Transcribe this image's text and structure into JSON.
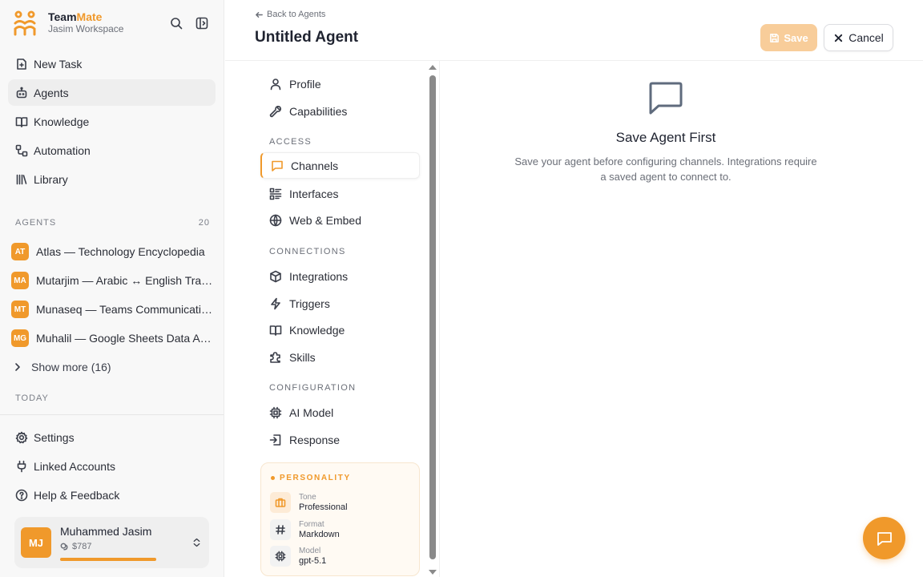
{
  "brand": {
    "name_part1": "Team",
    "name_part2": "Mate",
    "workspace": "Jasim Workspace"
  },
  "sidebar": {
    "nav": [
      {
        "label": "New Task",
        "icon": "new-task-icon"
      },
      {
        "label": "Agents",
        "icon": "robot-icon",
        "active": true
      },
      {
        "label": "Knowledge",
        "icon": "book-icon"
      },
      {
        "label": "Automation",
        "icon": "workflow-icon"
      },
      {
        "label": "Library",
        "icon": "library-icon"
      }
    ],
    "agents_section": {
      "title": "AGENTS",
      "count": "20"
    },
    "agents": [
      {
        "initials": "AT",
        "name": "Atlas — Technology Encyclopedia"
      },
      {
        "initials": "MA",
        "name": "Mutarjim — Arabic ↔ English Translator"
      },
      {
        "initials": "MT",
        "name": "Munaseq — Teams Communication Coordinator"
      },
      {
        "initials": "MG",
        "name": "Muhalil — Google Sheets Data Analyst"
      }
    ],
    "show_more": "Show more (16)",
    "today_title": "TODAY",
    "bottom_nav": [
      {
        "label": "Settings",
        "icon": "gear-icon"
      },
      {
        "label": "Linked Accounts",
        "icon": "plug-icon"
      },
      {
        "label": "Help & Feedback",
        "icon": "help-icon"
      }
    ],
    "user": {
      "initials": "MJ",
      "name": "Muhammed Jasim",
      "credit": "$787"
    }
  },
  "header": {
    "back": "Back to Agents",
    "title": "Untitled Agent",
    "save_label": "Save",
    "cancel_label": "Cancel"
  },
  "settings_nav": {
    "top": [
      {
        "label": "Profile",
        "icon": "user-icon"
      },
      {
        "label": "Capabilities",
        "icon": "wrench-icon"
      }
    ],
    "access_title": "ACCESS",
    "access": [
      {
        "label": "Channels",
        "icon": "chat-icon",
        "active": true
      },
      {
        "label": "Interfaces",
        "icon": "interfaces-icon"
      },
      {
        "label": "Web & Embed",
        "icon": "globe-icon"
      }
    ],
    "connections_title": "CONNECTIONS",
    "connections": [
      {
        "label": "Integrations",
        "icon": "cube-icon"
      },
      {
        "label": "Triggers",
        "icon": "bolt-icon"
      },
      {
        "label": "Knowledge",
        "icon": "book-icon"
      },
      {
        "label": "Skills",
        "icon": "puzzle-icon"
      }
    ],
    "configuration_title": "CONFIGURATION",
    "configuration": [
      {
        "label": "AI Model",
        "icon": "chip-icon"
      },
      {
        "label": "Response",
        "icon": "response-icon"
      }
    ]
  },
  "personality": {
    "title": "PERSONALITY",
    "tone_label": "Tone",
    "tone_value": "Professional",
    "format_label": "Format",
    "format_value": "Markdown",
    "model_label": "Model",
    "model_value": "gpt-5.1"
  },
  "main": {
    "empty_title": "Save Agent First",
    "empty_desc": "Save your agent before configuring channels. Integrations require a saved agent to connect to."
  },
  "colors": {
    "accent": "#f0992b",
    "accent_light": "#f8cd9a"
  }
}
